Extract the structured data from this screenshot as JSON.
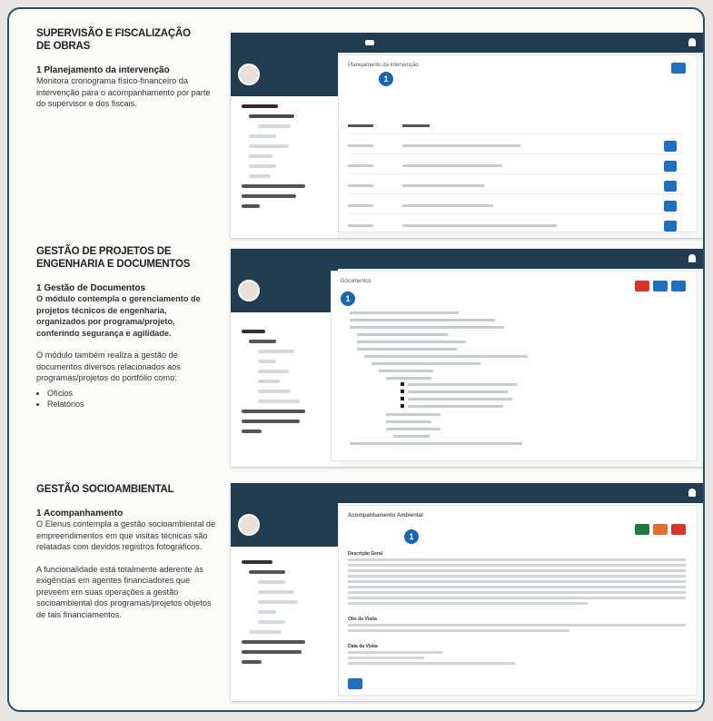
{
  "sections": [
    {
      "title_lines": [
        "SUPERVISÃO E FISCALIZAÇÃO",
        "DE OBRAS"
      ],
      "subtitle": "1 Planejamento da intervenção",
      "paragraph": "Monitora cronograma físico-financeiro da intervenção para o acompanhamento por parte do supervisor e dos fiscais.",
      "screen": {
        "panel_title": "Planejamento da intervenção",
        "badge": "1"
      }
    },
    {
      "title_lines": [
        "GESTÃO DE PROJETOS DE",
        "ENGENHARIA E DOCUMENTOS"
      ],
      "subtitle": "1 Gestão de Documentos",
      "paragraph_bold": "O módulo contempla o gerenciamento de projetos técnicos de engenharia, organizados por programa/projeto, conferindo segurança e agilidade.",
      "paragraph": "O módulo também realiza a gestão de documentos diversos relacionados aos programas/projetos do portfólio como:",
      "bullets": [
        "Ofícios",
        "Relatórios"
      ],
      "screen": {
        "panel_title": "Documentos",
        "badge": "1"
      }
    },
    {
      "title_lines": [
        "GESTÃO SOCIOAMBIENTAL"
      ],
      "subtitle": "1 Acompanhamento",
      "paragraph": "O Elenus contempla a gestão socioambiental de empreendimentos em que visitas técnicas são relatadas com devidos registros fotográficos.",
      "paragraph2": "A funcionalidade está totalmente aderente às exigências em agentes financiadores que preveem em suas operações a gestão socioambiental dos programas/projetos objetos de tais financiamentos.",
      "screen": {
        "panel_title": "Acompanhamento Ambiental",
        "badge": "1",
        "label_desc": "Descrição Geral",
        "label_obs": "Obs do Visita",
        "label_date": "Data da Visita"
      }
    }
  ],
  "colors": {
    "navy": "#233d50",
    "blue": "#1f6fc1",
    "red": "#d9352b",
    "green": "#1f7a3d",
    "orange": "#e2702a"
  }
}
